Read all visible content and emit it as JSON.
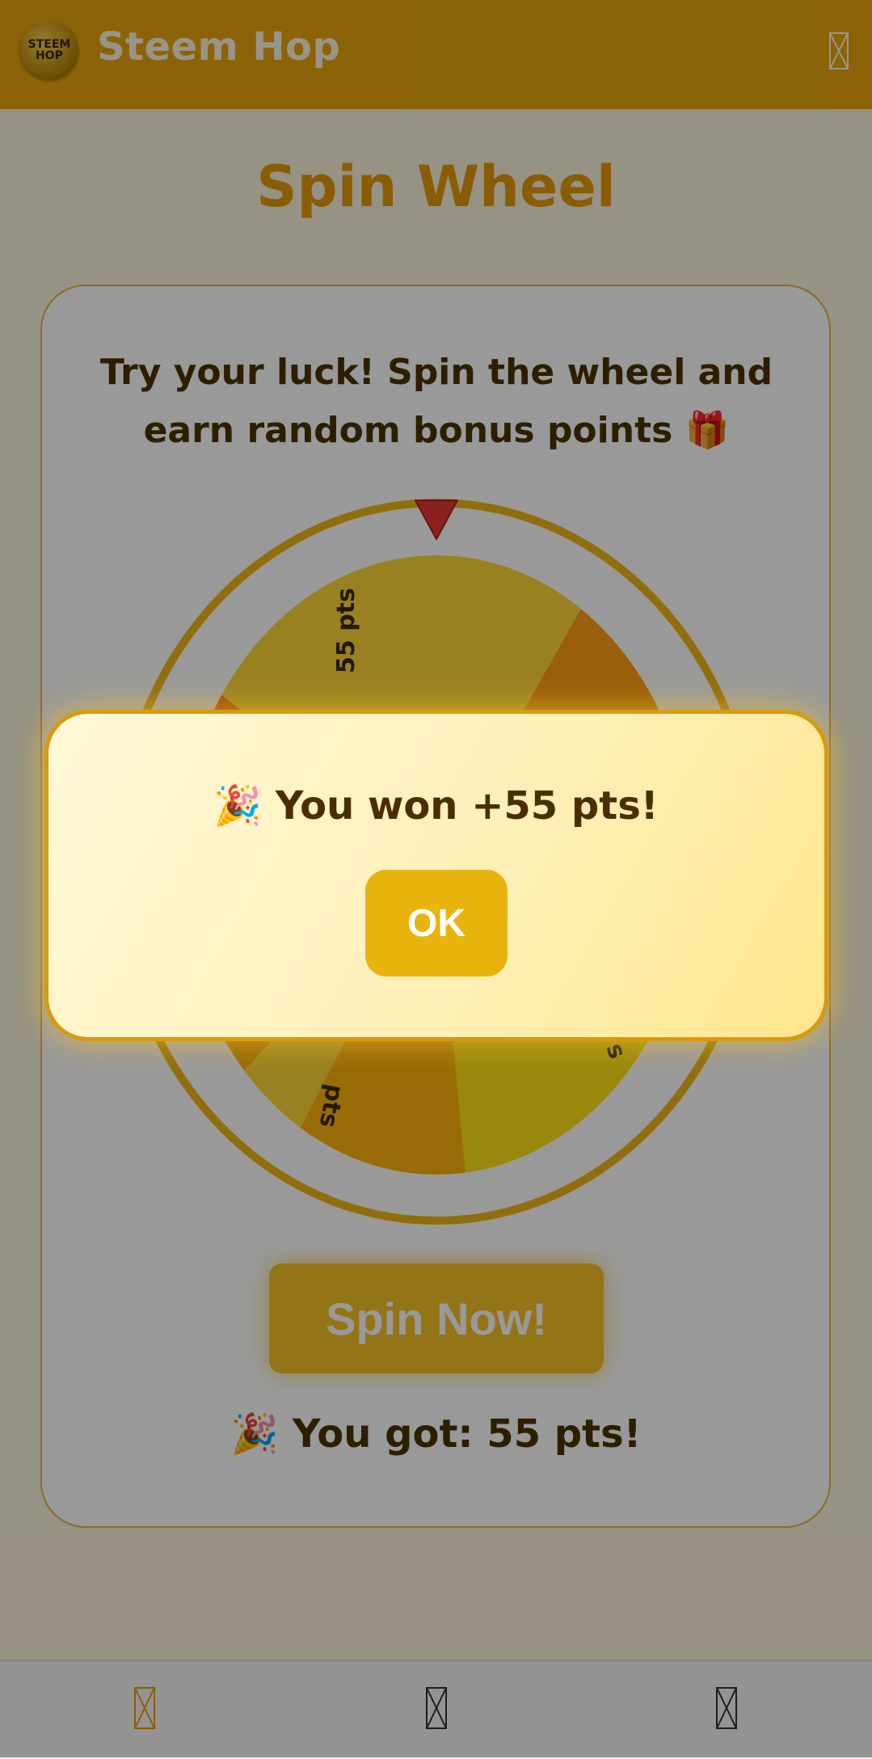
{
  "app": {
    "name": "Steem Hop",
    "logo_line1": "STEEM",
    "logo_line2": "HOP"
  },
  "header": {
    "menu_icon": "menu-icon"
  },
  "page": {
    "title": "Spin Wheel",
    "description": "Try your luck! Spin the wheel and earn random bonus points 🎁",
    "spin_button_label": "Spin Now!",
    "result_text": "🎉 You got: 55 pts!"
  },
  "wheel": {
    "visible_labels": [
      "55 pts",
      "pts",
      "s"
    ],
    "pointer_color": "#e53935",
    "ring_color": "#f1b817"
  },
  "modal": {
    "message": "🎉 You won +55 pts!",
    "ok_label": "OK"
  },
  "bottom_nav": {
    "items": [
      {
        "icon": "home-icon"
      },
      {
        "icon": "profile-icon"
      },
      {
        "icon": "settings-icon"
      }
    ]
  },
  "colors": {
    "header_bg": "#e9a60d",
    "accent": "#e79b07",
    "text_dark": "#4e3200",
    "button": "#f6c429"
  }
}
